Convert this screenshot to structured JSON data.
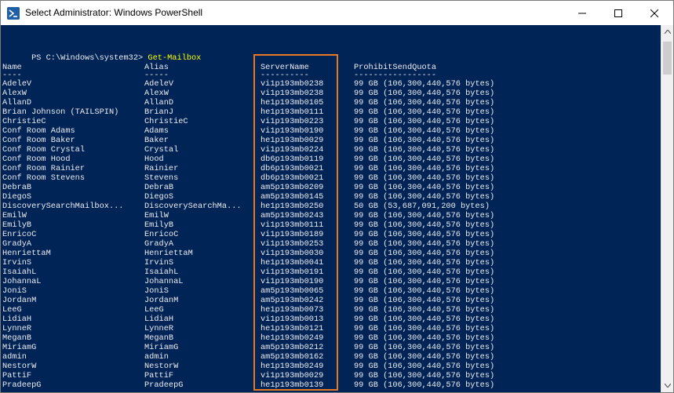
{
  "window": {
    "title": "Select Administrator: Windows PowerShell"
  },
  "prompt": {
    "text": "PS C:\\Windows\\system32> ",
    "command": "Get-Mailbox"
  },
  "table": {
    "headers": [
      "Name",
      "Alias",
      "ServerName",
      "ProhibitSendQuota"
    ],
    "underlines": [
      "----",
      "-----",
      "----------",
      "-----------------"
    ],
    "rows": [
      [
        "AdeleV",
        "AdeleV",
        "vi1p193mb0238",
        "99 GB (106,300,440,576 bytes)"
      ],
      [
        "AlexW",
        "AlexW",
        "vi1p193mb0238",
        "99 GB (106,300,440,576 bytes)"
      ],
      [
        "AllanD",
        "AllanD",
        "he1p193mb0105",
        "99 GB (106,300,440,576 bytes)"
      ],
      [
        "Brian Johnson (TAILSPIN)",
        "BrianJ",
        "he1p193mb0111",
        "99 GB (106,300,440,576 bytes)"
      ],
      [
        "ChristieC",
        "ChristieC",
        "vi1p193mb0223",
        "99 GB (106,300,440,576 bytes)"
      ],
      [
        "Conf Room Adams",
        "Adams",
        "vi1p193mb0190",
        "99 GB (106,300,440,576 bytes)"
      ],
      [
        "Conf Room Baker",
        "Baker",
        "he1p193mb0029",
        "99 GB (106,300,440,576 bytes)"
      ],
      [
        "Conf Room Crystal",
        "Crystal",
        "vi1p193mb0224",
        "99 GB (106,300,440,576 bytes)"
      ],
      [
        "Conf Room Hood",
        "Hood",
        "db6p193mb0119",
        "99 GB (106,300,440,576 bytes)"
      ],
      [
        "Conf Room Rainier",
        "Rainier",
        "db6p193mb0021",
        "99 GB (106,300,440,576 bytes)"
      ],
      [
        "Conf Room Stevens",
        "Stevens",
        "db6p193mb0021",
        "99 GB (106,300,440,576 bytes)"
      ],
      [
        "DebraB",
        "DebraB",
        "am5p193mb0209",
        "99 GB (106,300,440,576 bytes)"
      ],
      [
        "DiegoS",
        "DiegoS",
        "am5p193mb0145",
        "99 GB (106,300,440,576 bytes)"
      ],
      [
        "DiscoverySearchMailbox...",
        "DiscoverySearchMa...",
        "he1p193mb0250",
        "50 GB (53,687,091,200 bytes)"
      ],
      [
        "EmilW",
        "EmilW",
        "am5p193mb0243",
        "99 GB (106,300,440,576 bytes)"
      ],
      [
        "EmilyB",
        "EmilyB",
        "vi1p193mb0111",
        "99 GB (106,300,440,576 bytes)"
      ],
      [
        "EnricoC",
        "EnricoC",
        "vi1p193mb0189",
        "99 GB (106,300,440,576 bytes)"
      ],
      [
        "GradyA",
        "GradyA",
        "vi1p193mb0253",
        "99 GB (106,300,440,576 bytes)"
      ],
      [
        "HenriettaM",
        "HenriettaM",
        "vi1p193mb0030",
        "99 GB (106,300,440,576 bytes)"
      ],
      [
        "IrvinS",
        "IrvinS",
        "he1p193mb0041",
        "99 GB (106,300,440,576 bytes)"
      ],
      [
        "IsaiahL",
        "IsaiahL",
        "vi1p193mb0191",
        "99 GB (106,300,440,576 bytes)"
      ],
      [
        "JohannaL",
        "JohannaL",
        "vi1p193mb0190",
        "99 GB (106,300,440,576 bytes)"
      ],
      [
        "JoniS",
        "JoniS",
        "am5p193mb0065",
        "99 GB (106,300,440,576 bytes)"
      ],
      [
        "JordanM",
        "JordanM",
        "am5p193mb0242",
        "99 GB (106,300,440,576 bytes)"
      ],
      [
        "LeeG",
        "LeeG",
        "he1p193mb0073",
        "99 GB (106,300,440,576 bytes)"
      ],
      [
        "LidiaH",
        "LidiaH",
        "vi1p193mb0013",
        "99 GB (106,300,440,576 bytes)"
      ],
      [
        "LynneR",
        "LynneR",
        "he1p193mb0121",
        "99 GB (106,300,440,576 bytes)"
      ],
      [
        "MeganB",
        "MeganB",
        "he1p193mb0249",
        "99 GB (106,300,440,576 bytes)"
      ],
      [
        "MiriamG",
        "MiriamG",
        "am5p193mb0212",
        "99 GB (106,300,440,576 bytes)"
      ],
      [
        "admin",
        "admin",
        "am5p193mb0162",
        "99 GB (106,300,440,576 bytes)"
      ],
      [
        "NestorW",
        "NestorW",
        "he1p193mb0249",
        "99 GB (106,300,440,576 bytes)"
      ],
      [
        "PattiF",
        "PattiF",
        "vi1p193mb0029",
        "99 GB (106,300,440,576 bytes)"
      ],
      [
        "PradeepG",
        "PradeepG",
        "he1p193mb0139",
        "99 GB (106,300,440,576 bytes)"
      ]
    ]
  },
  "colors": {
    "console_bg": "#012456",
    "console_text": "#eeedf0",
    "command_text": "#ffff00",
    "highlight": "#e87722"
  },
  "icons": {
    "app": "powershell-icon",
    "minimize": "minimize-icon",
    "maximize": "maximize-icon",
    "close": "close-icon"
  }
}
